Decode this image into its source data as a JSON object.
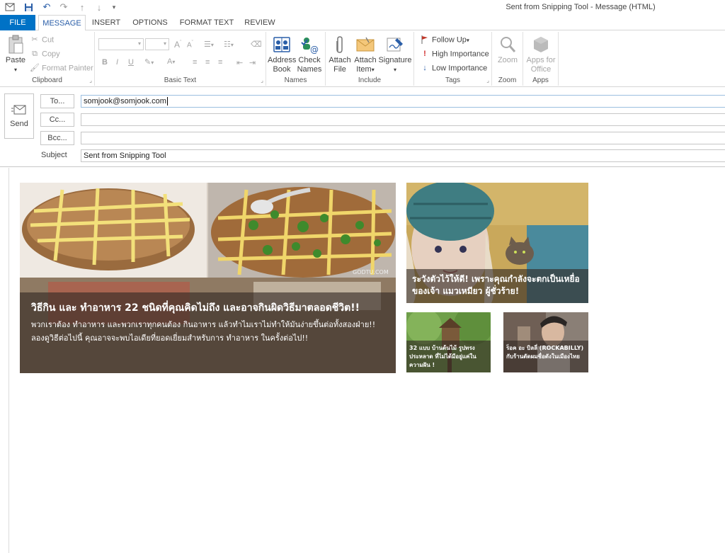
{
  "window": {
    "title": "Sent from Snipping Tool - Message (HTML)"
  },
  "quick_access": {
    "icons": [
      "outlook-icon",
      "save-icon",
      "undo-icon",
      "redo-icon",
      "up-arrow-icon",
      "down-arrow-icon",
      "customize-icon"
    ]
  },
  "tabs": [
    "FILE",
    "MESSAGE",
    "INSERT",
    "OPTIONS",
    "FORMAT TEXT",
    "REVIEW"
  ],
  "active_tab": "MESSAGE",
  "ribbon": {
    "clipboard": {
      "label": "Clipboard",
      "paste": "Paste",
      "cut": "Cut",
      "copy": "Copy",
      "format_painter": "Format Painter"
    },
    "basic_text": {
      "label": "Basic Text",
      "bold": "B",
      "italic": "I",
      "underline": "U"
    },
    "names": {
      "label": "Names",
      "address_book_1": "Address",
      "address_book_2": "Book",
      "check_names_1": "Check",
      "check_names_2": "Names"
    },
    "include": {
      "label": "Include",
      "attach_file_1": "Attach",
      "attach_file_2": "File",
      "attach_item_1": "Attach",
      "attach_item_2": "Item",
      "signature": "Signature"
    },
    "tags": {
      "label": "Tags",
      "follow_up": "Follow Up",
      "high_importance": "High Importance",
      "low_importance": "Low Importance"
    },
    "zoom": {
      "label": "Zoom",
      "zoom": "Zoom"
    },
    "apps": {
      "label": "Apps",
      "apps_for_office_1": "Apps for",
      "apps_for_office_2": "Office"
    }
  },
  "compose": {
    "send_label": "Send",
    "to_label": "To...",
    "cc_label": "Cc...",
    "bcc_label": "Bcc...",
    "subject_label": "Subject",
    "to_value": "somjook@somjook.com",
    "cc_value": "",
    "bcc_value": "",
    "subject_value": "Sent from Snipping Tool"
  },
  "body": {
    "main_card": {
      "watermark": "GODTU.COM",
      "headline": "วิธีกิน และ ทำอาหาร 22 ชนิดที่คุณคิดไม่ถึง และอาจกินผิดวิธีมาตลอดชีวิต!!",
      "description": "พวกเราต้อง ทำอาหาร และพวกเราทุกคนต้อง กินอาหาร แล้วทำไมเราไม่ทำให้มันง่ายขึ้นต่อทั้งสองฝ่าย!! ลองดูวิธีต่อไปนี้ คุณอาจจะพบไอเดียที่ยอดเยี่ยมสำหรับการ ทำอาหาร ในครั้งต่อไป!!"
    },
    "right_card": {
      "headline": "ระวังตัวไว้ให้ดี! เพราะคุณกำลังจะตกเป็นเหยื่อของเจ้า แมวเหมียว ผู้ชั่วร้าย!"
    },
    "small_card_1": {
      "headline": "32 แบบ บ้านต้นไม้ รูปทรงประหลาด ที่ไม่ได้มีอยู่แค่ในความฝัน !"
    },
    "small_card_2": {
      "headline": "ร็อค อะ บิลลี่ (ROCKABILLY) กับร้านตัดผมชื่อดังในเมืองไทย"
    }
  },
  "colors": {
    "accent": "#0072c6",
    "active_tab_text": "#2a5ea8",
    "follow_up_flag": "#c0392b",
    "high_importance": "#d12e2e",
    "low_importance": "#2a5ea8"
  }
}
